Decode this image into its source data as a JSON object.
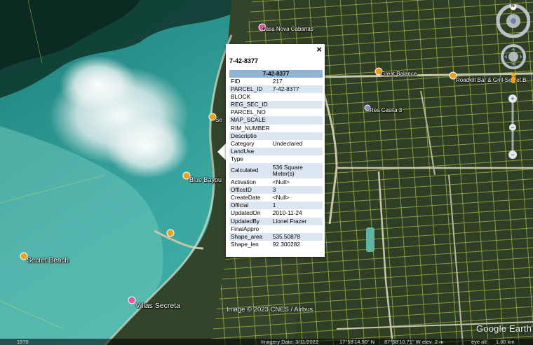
{
  "map": {
    "places": [
      {
        "name": "Casa Nova Cabanas",
        "color": "#e8559a"
      },
      {
        "name": "Great Balance",
        "color": "#f0a020"
      },
      {
        "name": "Roadkill Bar & Grill-Secret Beach",
        "color": "#f0a020"
      },
      {
        "name": "Rea Casita 3",
        "color": "#8a8ad0"
      },
      {
        "name": "Blue Bayou",
        "color": "#f0a020"
      },
      {
        "name": "Secret Beach",
        "color": "#f0a020"
      },
      {
        "name": "Villas Secreta",
        "color": "#e8559a"
      },
      {
        "name": "Se",
        "color": "#f0a020"
      }
    ],
    "attribution": "Image © 2023 CNES / Airbus",
    "logo": "Google Earth",
    "status": {
      "year": "1970",
      "imagery_date": "Imagery Date: 3/11/2022",
      "lat": "17°58'14.90\" N",
      "lon": "87°58'10.71\" W",
      "elev": "elev",
      "elev_value": "2 m",
      "eye_alt": "eye alt",
      "eye_alt_value": "1.60 km"
    },
    "compass_label": "N"
  },
  "popup": {
    "title": "7-42-8377",
    "header": "7-42-8377",
    "close_icon": "×",
    "rows": [
      {
        "key": "FID",
        "value": "217"
      },
      {
        "key": "PARCEL_ID",
        "value": "7-42-8377"
      },
      {
        "key": "BLOCK",
        "value": ""
      },
      {
        "key": "REG_SEC_ID",
        "value": ""
      },
      {
        "key": "PARCEL_NO",
        "value": ""
      },
      {
        "key": "MAP_SCALE",
        "value": ""
      },
      {
        "key": "RIM_NUMBER",
        "value": ""
      },
      {
        "key": "Descriptio",
        "value": ""
      },
      {
        "key": "Category",
        "value": "Undeclared"
      },
      {
        "key": "LandUse",
        "value": ""
      },
      {
        "key": "Type",
        "value": ""
      },
      {
        "key": "Calculated",
        "value": "536 Square Meter(s)"
      },
      {
        "key": "Activation",
        "value": "<Null>"
      },
      {
        "key": "OfficeID",
        "value": "3"
      },
      {
        "key": "CreateDate",
        "value": "<Null>"
      },
      {
        "key": "Official",
        "value": "1"
      },
      {
        "key": "UpdatedOn",
        "value": "2010-11-24"
      },
      {
        "key": "UpdatedBy",
        "value": "Lionel Frazer"
      },
      {
        "key": "FinalAppro",
        "value": ""
      },
      {
        "key": "Shape_area",
        "value": "535.50878"
      },
      {
        "key": "Shape_len",
        "value": "92.300282"
      }
    ]
  }
}
